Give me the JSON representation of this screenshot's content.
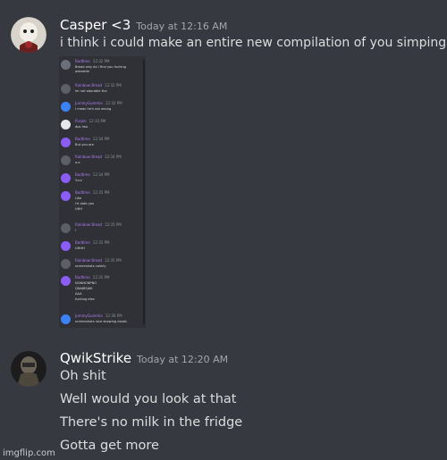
{
  "messages": [
    {
      "author": "Casper <3",
      "timestamp": "Today at 12:16 AM",
      "lines": [
        "i think i could make an entire new compilation of you simping fr"
      ]
    },
    {
      "author": "QwikStrike",
      "timestamp": "Today at 12:20 AM",
      "lines": [
        "Oh shit",
        "Well would you look at that",
        "There's no milk in the fridge",
        "Gotta get more"
      ]
    }
  ],
  "embed": {
    "messages": [
      {
        "author": "Badtime",
        "time": "12:32 PM",
        "lines": [
          "Bread why do I find you fucking",
          "adorable"
        ]
      },
      {
        "author": "Rainbow Bread",
        "time": "12:32 PM",
        "lines": [
          "im not adorable tho"
        ]
      },
      {
        "author": "JummyGummie",
        "time": "12:32 PM",
        "lines": [
          "I mean he's not wrong"
        ]
      },
      {
        "author": "Purple",
        "time": "12:33 PM",
        "lines": [
          "dps lmo"
        ]
      },
      {
        "author": "Badtime",
        "time": "12:34 PM",
        "lines": [
          "But you are"
        ]
      },
      {
        "author": "Rainbow Bread",
        "time": "12:34 PM",
        "lines": [
          "o.o"
        ]
      },
      {
        "author": "Badtime",
        "time": "12:34 PM",
        "lines": [
          "Y.o.s"
        ]
      },
      {
        "author": "Badtime",
        "time": "12:35 PM",
        "lines": [
          "Like",
          "I'd date you",
          "UHH"
        ]
      },
      {
        "author": "Rainbow Bread",
        "time": "12:35 PM",
        "lines": [
          "!"
        ]
      },
      {
        "author": "Badtime",
        "time": "12:35 PM",
        "lines": [
          "UHHH"
        ]
      },
      {
        "author": "Rainbow Bread",
        "time": "12:35 PM",
        "lines": [
          "screenshots calmly"
        ]
      },
      {
        "author": "Badtime",
        "time": "12:35 PM",
        "lines": [
          "NONNONPNO",
          "QNAJBSJAK",
          "AAA",
          "fucking dies"
        ]
      },
      {
        "author": "JummyGummie",
        "time": "12:36 PM",
        "lines": [
          "screenshots nice showing doubt"
        ]
      }
    ]
  },
  "watermark": "imgflip.com",
  "colors": {
    "background": "#36393f",
    "username": "#ffffff",
    "timestamp": "#a3a6aa",
    "embed_username": "#b17bf0"
  }
}
